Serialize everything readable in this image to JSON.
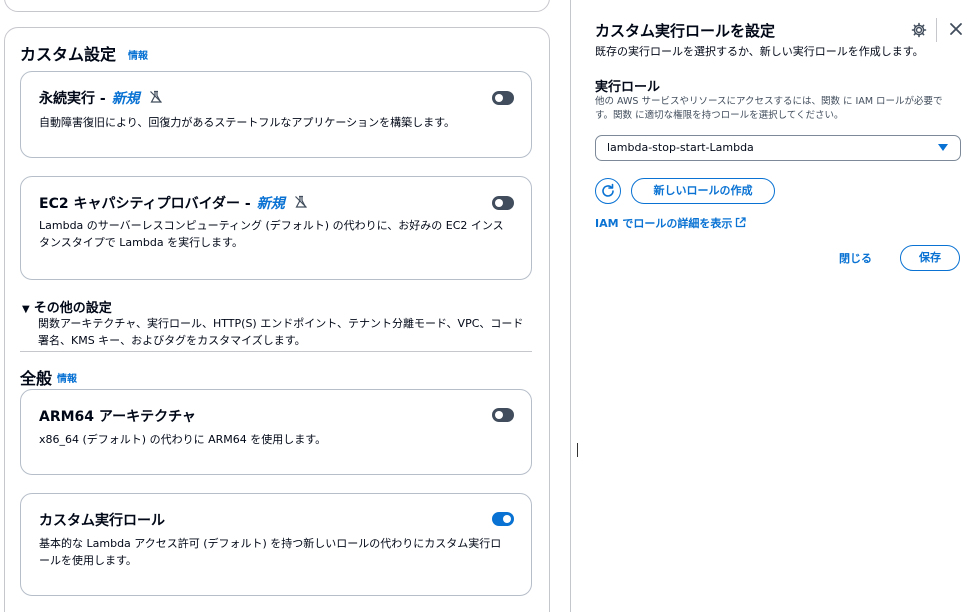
{
  "left": {
    "section_title": "カスタム設定",
    "section_info": "情報",
    "tiles": [
      {
        "title": "永続実行 -",
        "badge": "新規",
        "desc": "自動障害復旧により、回復力があるステートフルなアプリケーションを構築します。",
        "toggle": "off"
      },
      {
        "title": "EC2 キャパシティプロバイダー -",
        "badge": "新規",
        "desc": "Lambda のサーバーレスコンピューティング (デフォルト) の代わりに、お好みの EC2 インスタンスタイプで Lambda を実行します。",
        "toggle": "off"
      }
    ],
    "other_settings": {
      "label": "その他の設定",
      "desc": "関数アーキテクチャ、実行ロール、HTTP(S) エンドポイント、テナント分離モード、VPC、コード署名、KMS キー、およびタグをカスタマイズします。"
    },
    "general": {
      "title": "全般",
      "info": "情報"
    },
    "arm64": {
      "title": "ARM64 アーキテクチャ",
      "desc": "x86_64 (デフォルト) の代わりに ARM64 を使用します。",
      "toggle": "off"
    },
    "custom_role": {
      "title": "カスタム実行ロール",
      "desc": "基本的な Lambda アクセス許可 (デフォルト) を持つ新しいロールの代わりにカスタム実行ロールを使用します。",
      "toggle": "on"
    }
  },
  "panel": {
    "title": "カスタム実行ロールを設定",
    "subtitle": "既存の実行ロールを選択するか、新しい実行ロールを作成します。",
    "role_label": "実行ロール",
    "role_desc": "他の AWS サービスやリソースにアクセスするには、関数 に IAM ロールが必要です。関数 に適切な権限を持つロールを選択してください。",
    "selected_role": "lambda-stop-start-Lambda",
    "create_role": "新しいロールの作成",
    "iam_link": "IAM でロールの詳細を表示",
    "close_label": "閉じる",
    "save_label": "保存"
  },
  "colors": {
    "accent": "#0972d3",
    "text": "#000716",
    "border": "#c6c6cd"
  },
  "icons": [
    "flask-off-icon",
    "gear-icon",
    "close-icon",
    "refresh-icon",
    "external-link-icon",
    "caret-down-icon"
  ]
}
